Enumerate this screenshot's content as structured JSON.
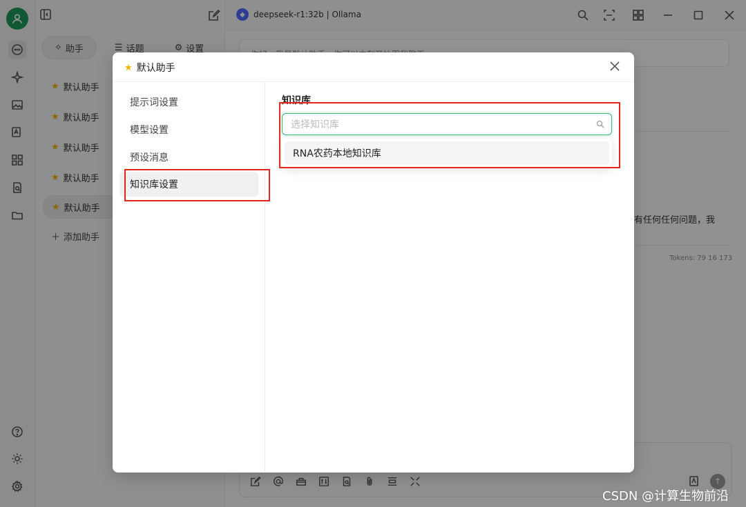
{
  "sidebar": {
    "tabs": [
      {
        "icon": "sparkle-icon",
        "label": "助手"
      },
      {
        "icon": "list-icon",
        "label": "话题"
      },
      {
        "icon": "gear-icon",
        "label": "设置"
      }
    ],
    "assistants": [
      "默认助手",
      "默认助手",
      "默认助手",
      "默认助手",
      "默认助手"
    ],
    "add_assistant": "添加助手",
    "add_icon": "＋"
  },
  "topbar": {
    "model_name": "deepseek-r1:32b | Ollama"
  },
  "chat": {
    "greeting": "你好，我是默认助手，你可以立刻开始跟我聊天",
    "reply_fragment": "有任何任何问题，我",
    "tokens": "Tokens: 79 16 173"
  },
  "modal": {
    "title": "默认助手",
    "nav": [
      "提示词设置",
      "模型设置",
      "预设消息",
      "知识库设置"
    ],
    "active_nav": 3,
    "knowledge_base": {
      "label": "知识库",
      "placeholder": "选择知识库",
      "options": [
        "RNA农药本地知识库"
      ]
    }
  },
  "watermark": "CSDN @计算生物前沿",
  "colors": {
    "accent": "#32bb79",
    "highlight": "#e2261a",
    "avatar": "#1e9a5a",
    "star": "#f0b400"
  }
}
